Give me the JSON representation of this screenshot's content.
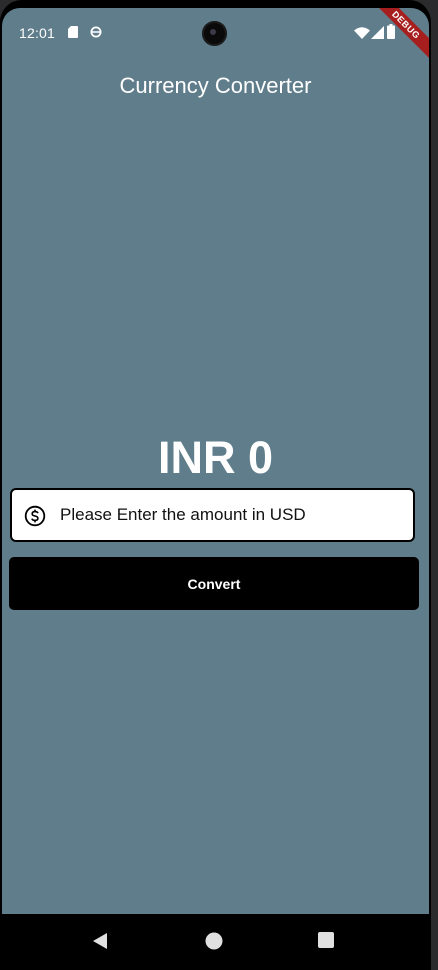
{
  "status_bar": {
    "time": "12:01",
    "icons": [
      "sd-card-icon",
      "sync-icon",
      "wifi-icon",
      "signal-icon",
      "battery-icon"
    ]
  },
  "debug_banner": "DEBUG",
  "app_bar": {
    "title": "Currency Converter"
  },
  "main": {
    "result_text": "INR 0",
    "amount_field": {
      "placeholder": "Please Enter the amount in USD",
      "value": "",
      "prefix_icon": "dollar-circle-icon"
    },
    "convert_button_label": "Convert"
  },
  "nav_bar": {
    "icons": [
      "back-icon",
      "home-icon",
      "recents-icon"
    ]
  },
  "colors": {
    "background": "#607d8b",
    "button": "#000000",
    "text_light": "#ffffff",
    "debug": "#a61e1e"
  }
}
